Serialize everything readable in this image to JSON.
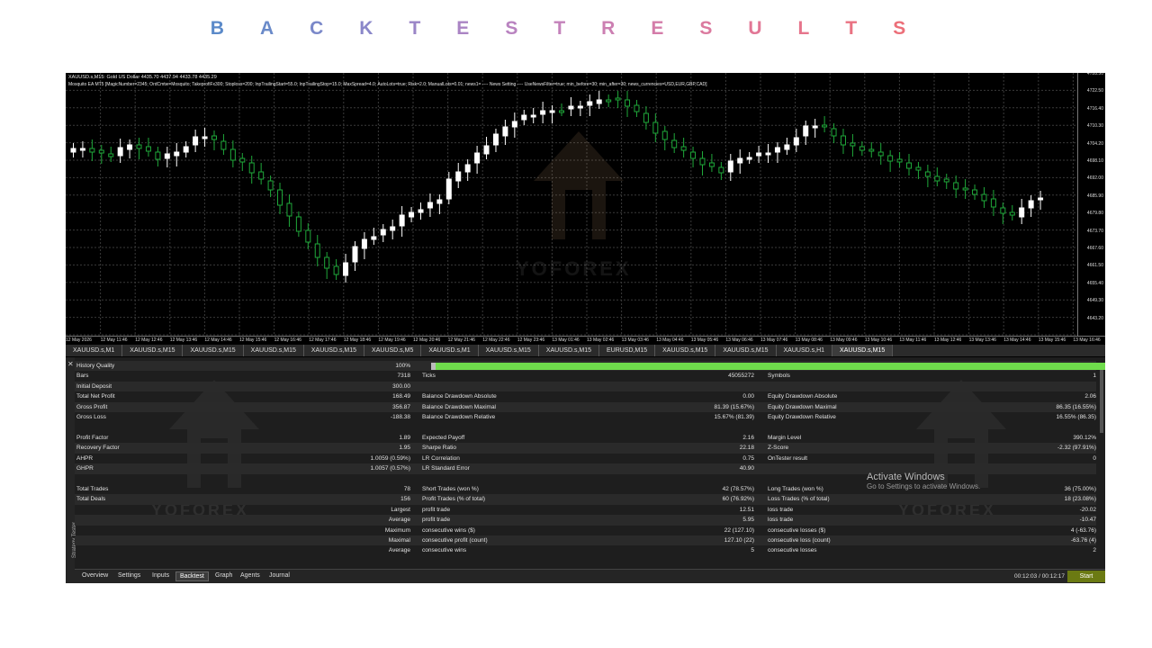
{
  "banner": {
    "letters": [
      "B",
      "A",
      "C",
      "K",
      "T",
      "E",
      "S",
      "T",
      "R",
      "E",
      "S",
      "U",
      "L",
      "T",
      "S"
    ],
    "colors": [
      "#5b8ac9",
      "#6a8ac9",
      "#7a88c9",
      "#8a87c9",
      "#9a85c7",
      "#aa84c4",
      "#b983c0",
      "#c482bb",
      "#cc7fb2",
      "#d47ca9",
      "#db7a9f",
      "#e27796",
      "#e6758c",
      "#e97282",
      "#ec6f79"
    ]
  },
  "chart": {
    "header_line1": "XAUUSD.s,M15:  Gold US Dollar  4435.70 4437.94 4433.78 4435.29",
    "header_line2": "Mosquito EA MT5 [MagicNumber=2345; OrdCmtw=Mosquito; TakeprofiFx300; Stoploss=200; InpTrailingStart=55.0; InpTrailingStop=15.0; MaxSpread=4.0; AutoLots=true; Risk=2.0; ManualLots=0.01; news1=  ----  News Setting  ----  UseNewsFilter=true; min_before=30; min_after=30; news_currencies=USD,EUR,GBP,CAD]",
    "price_labels": [
      "4728.50",
      "4722.50",
      "4716.40",
      "4710.30",
      "4704.20",
      "4698.10",
      "4692.00",
      "4685.90",
      "4679.80",
      "4673.70",
      "4667.60",
      "4661.50",
      "4655.40",
      "4649.30",
      "4643.20"
    ],
    "time_labels": [
      "12 May 2026",
      "12 May 11:46",
      "12 May 12:46",
      "12 May 13:46",
      "12 May 14:46",
      "12 May 15:46",
      "12 May 16:46",
      "12 May 17:46",
      "12 May 18:46",
      "12 May 19:46",
      "12 May 20:46",
      "12 May 21:46",
      "12 May 22:46",
      "12 May 23:46",
      "13 May 01:46",
      "13 May 02:46",
      "13 May 03:46",
      "13 May 04:46",
      "13 May 05:46",
      "13 May 06:46",
      "13 May 07:46",
      "13 May 08:46",
      "13 May 09:46",
      "13 May 10:46",
      "13 May 11:46",
      "13 May 12:46",
      "13 May 13:46",
      "13 May 14:46",
      "13 May 15:46",
      "13 May 16:46"
    ],
    "watermark": "YOFOREX",
    "colors": {
      "bull": "#ffffff",
      "bear": "#1fa83a",
      "grid": "#3a3a3a"
    }
  },
  "symbol_tabs": [
    {
      "label": "XAUUSD.s,M1",
      "active": false
    },
    {
      "label": "XAUUSD.s,M15",
      "active": false
    },
    {
      "label": "XAUUSD.s,M15",
      "active": false
    },
    {
      "label": "XAUUSD.s,M15",
      "active": false
    },
    {
      "label": "XAUUSD.s,M15",
      "active": false
    },
    {
      "label": "XAUUSD.s,M5",
      "active": false
    },
    {
      "label": "XAUUSD.s,M1",
      "active": false
    },
    {
      "label": "XAUUSD.s,M15",
      "active": false
    },
    {
      "label": "XAUUSD.s,M15",
      "active": false
    },
    {
      "label": "EURUSD,M15",
      "active": false
    },
    {
      "label": "XAUUSD.s,M15",
      "active": false
    },
    {
      "label": "XAUUSD.s,M15",
      "active": false
    },
    {
      "label": "XAUUSD.s,H1",
      "active": false
    },
    {
      "label": "XAUUSD.s,M15",
      "active": true
    }
  ],
  "results": {
    "history_quality": {
      "label": "History Quality",
      "value": "100%"
    },
    "bars": {
      "label": "Bars",
      "value": "7318"
    },
    "ticks": {
      "label": "Ticks",
      "value": "45055272"
    },
    "symbols": {
      "label": "Symbols",
      "value": "1"
    },
    "initial_deposit": {
      "label": "Initial Deposit",
      "value": "300.00"
    },
    "total_net_profit": {
      "label": "Total Net Profit",
      "value": "168.49"
    },
    "balance_dd_abs": {
      "label": "Balance Drawdown Absolute",
      "value": "0.00"
    },
    "equity_dd_abs": {
      "label": "Equity Drawdown Absolute",
      "value": "2.06"
    },
    "gross_profit": {
      "label": "Gross Profit",
      "value": "356.87"
    },
    "balance_dd_max": {
      "label": "Balance Drawdown Maximal",
      "value": "81.39 (15.67%)"
    },
    "equity_dd_max": {
      "label": "Equity Drawdown Maximal",
      "value": "86.35 (16.55%)"
    },
    "gross_loss": {
      "label": "Gross Loss",
      "value": "-188.38"
    },
    "balance_dd_rel": {
      "label": "Balance Drawdown Relative",
      "value": "15.67% (81.39)"
    },
    "equity_dd_rel": {
      "label": "Equity Drawdown Relative",
      "value": "16.55% (86.35)"
    },
    "profit_factor": {
      "label": "Profit Factor",
      "value": "1.89"
    },
    "expected_payoff": {
      "label": "Expected Payoff",
      "value": "2.16"
    },
    "margin_level": {
      "label": "Margin Level",
      "value": "390.12%"
    },
    "recovery_factor": {
      "label": "Recovery Factor",
      "value": "1.95"
    },
    "sharpe_ratio": {
      "label": "Sharpe Ratio",
      "value": "22.18"
    },
    "z_score": {
      "label": "Z-Score",
      "value": "-2.32 (97.91%)"
    },
    "ahpr": {
      "label": "AHPR",
      "value": "1.0059 (0.59%)"
    },
    "lr_correlation": {
      "label": "LR Correlation",
      "value": "0.75"
    },
    "ontester": {
      "label": "OnTester result",
      "value": "0"
    },
    "ghpr": {
      "label": "GHPR",
      "value": "1.0057 (0.57%)"
    },
    "lr_std_error": {
      "label": "LR Standard Error",
      "value": "40.90"
    },
    "total_trades": {
      "label": "Total Trades",
      "value": "78"
    },
    "short_trades": {
      "label": "Short Trades (won %)",
      "value": "42 (78.57%)"
    },
    "long_trades": {
      "label": "Long Trades (won %)",
      "value": "36 (75.00%)"
    },
    "total_deals": {
      "label": "Total Deals",
      "value": "156"
    },
    "profit_trades": {
      "label": "Profit Trades (% of total)",
      "value": "60 (76.92%)"
    },
    "loss_trades": {
      "label": "Loss Trades (% of total)",
      "value": "18 (23.08%)"
    },
    "largest": {
      "label": "Largest",
      "profit_label": "profit trade",
      "profit": "12.51",
      "loss_label": "loss trade",
      "loss": "-20.02"
    },
    "average": {
      "label": "Average",
      "profit_label": "profit trade",
      "profit": "5.95",
      "loss_label": "loss trade",
      "loss": "-10.47"
    },
    "maximum": {
      "label": "Maximum",
      "wins_label": "consecutive wins ($)",
      "wins": "22 (127.10)",
      "losses_label": "consecutive losses ($)",
      "losses": "4 (-63.76)"
    },
    "maximal": {
      "label": "Maximal",
      "profit_label": "consecutive profit (count)",
      "profit": "127.10 (22)",
      "loss_label": "consecutive loss (count)",
      "loss": "-63.76 (4)"
    },
    "average_consec": {
      "label": "Average",
      "wins_label": "consecutive wins",
      "wins": "5",
      "losses_label": "consecutive losses",
      "losses": "2"
    }
  },
  "bottom_tabs": [
    "Overview",
    "Settings",
    "Inputs",
    "Backtest",
    "Graph",
    "Agents",
    "Journal"
  ],
  "active_bottom_tab": "Backtest",
  "side_label": "Strategy Tester",
  "time_status": "00:12:03 / 00:12:17",
  "start_label": "Start",
  "activate": {
    "line1": "Activate Windows",
    "line2": "Go to Settings to activate Windows."
  }
}
